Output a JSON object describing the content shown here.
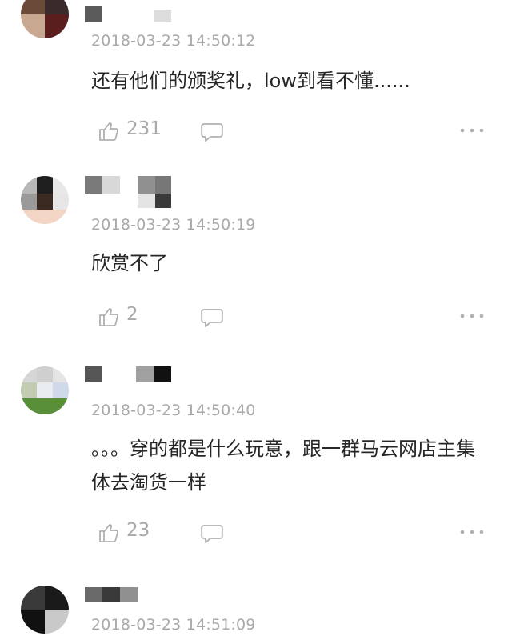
{
  "comments": [
    {
      "timestamp": "2018-03-23 14:50:12",
      "content": "还有他们的颁奖礼，low到看不懂......",
      "likes": "231"
    },
    {
      "timestamp": "2018-03-23 14:50:19",
      "content": "欣赏不了",
      "likes": "2"
    },
    {
      "timestamp": "2018-03-23 14:50:40",
      "content": "。。。穿的都是什么玩意，跟一群马云网店主集体去淘货一样",
      "likes": "23"
    },
    {
      "timestamp": "2018-03-23 14:51:09",
      "content": "",
      "likes": ""
    }
  ],
  "icons": {
    "like": "thumbs-up-icon",
    "reply": "comment-bubble-icon",
    "more": "more-dots-icon"
  },
  "colors": {
    "meta_gray": "#a9a9a9",
    "text": "#262626",
    "icon_gray": "#b0b0b0"
  }
}
